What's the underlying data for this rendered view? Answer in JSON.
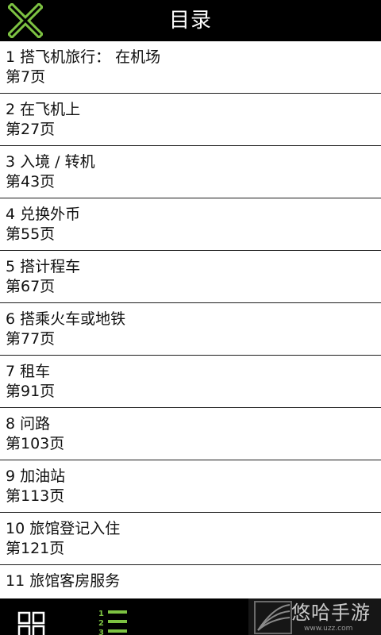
{
  "header": {
    "title": "目录",
    "close_icon": "close-x-icon",
    "accent_color": "#7dc242"
  },
  "toc": {
    "items": [
      {
        "title": "1 搭飞机旅行： 在机场",
        "page": "第7页"
      },
      {
        "title": "2 在飞机上",
        "page": "第27页"
      },
      {
        "title": "3 入境 /  转机",
        "page": "第43页"
      },
      {
        "title": "4 兑换外币",
        "page": "第55页"
      },
      {
        "title": "5 搭计程车",
        "page": "第67页"
      },
      {
        "title": "6 搭乘火车或地铁",
        "page": "第77页"
      },
      {
        "title": "7 租车",
        "page": "第91页"
      },
      {
        "title": "8 问路",
        "page": "第103页"
      },
      {
        "title": "9 加油站",
        "page": "第113页"
      },
      {
        "title": "10 旅馆登记入住",
        "page": "第121页"
      },
      {
        "title": "11 旅馆客房服务",
        "page": ""
      }
    ]
  },
  "bottom_bar": {
    "grid_icon": "grid-view-icon",
    "list_icon": "numbered-list-icon",
    "list_numbers": [
      "1",
      "2",
      "3"
    ]
  },
  "watermark": {
    "text": "悠哈手游",
    "sub": "www.uzz.com"
  }
}
